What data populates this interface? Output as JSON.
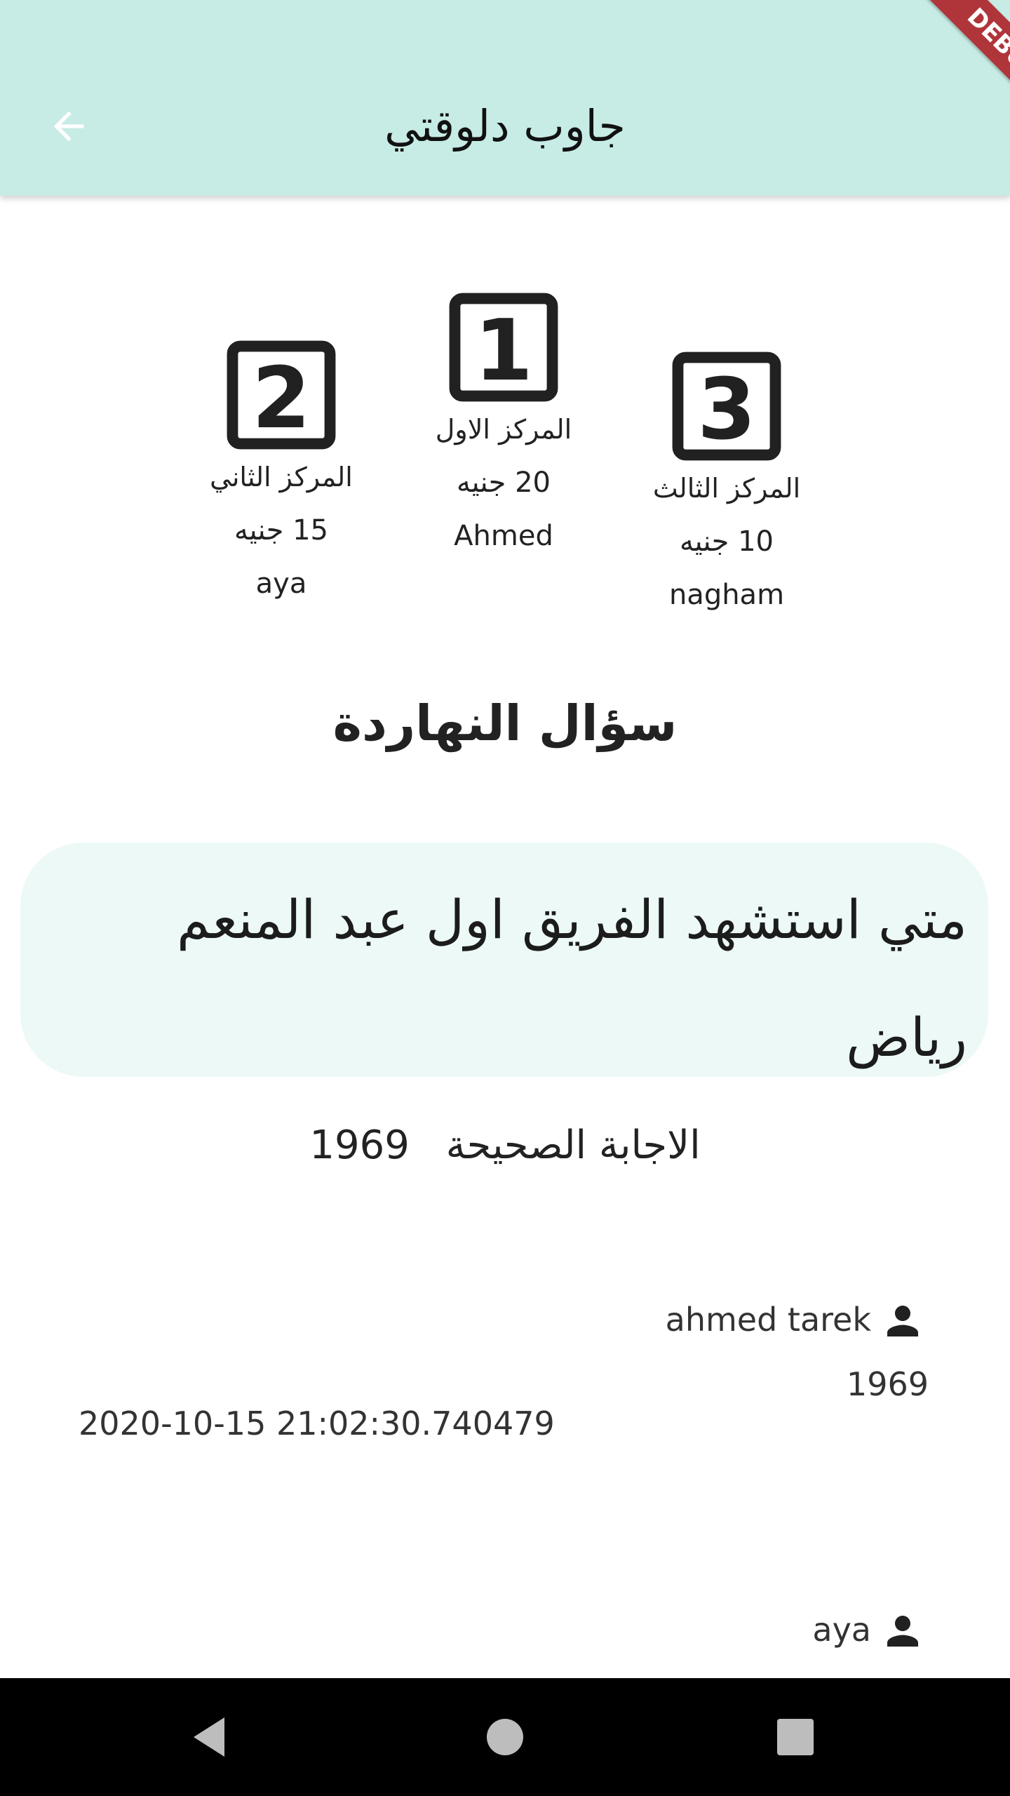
{
  "appbar": {
    "title": "جاوب دلوقتي",
    "debug_label": "DEBUG"
  },
  "podium": [
    {
      "rank": "1",
      "place": "المركز الاول",
      "prize": "20 جنيه",
      "winner": "Ahmed"
    },
    {
      "rank": "2",
      "place": "المركز الثاني",
      "prize": "15 جنيه",
      "winner": "aya"
    },
    {
      "rank": "3",
      "place": "المركز الثالث",
      "prize": "10 جنيه",
      "winner": "nagham"
    }
  ],
  "heading": "سؤال النهاردة",
  "question": "متي استشهد الفريق اول عبد المنعم رياض",
  "answer": {
    "label": "الاجابة الصحيحة",
    "value": "1969"
  },
  "responses": [
    {
      "user": "ahmed tarek",
      "answer": "1969",
      "timestamp": "2020-10-15 21:02:30.740479"
    },
    {
      "user": "aya"
    }
  ],
  "icons": [
    "back-arrow-icon",
    "person-icon",
    "nav-back-icon",
    "nav-home-icon",
    "nav-recents-icon"
  ]
}
